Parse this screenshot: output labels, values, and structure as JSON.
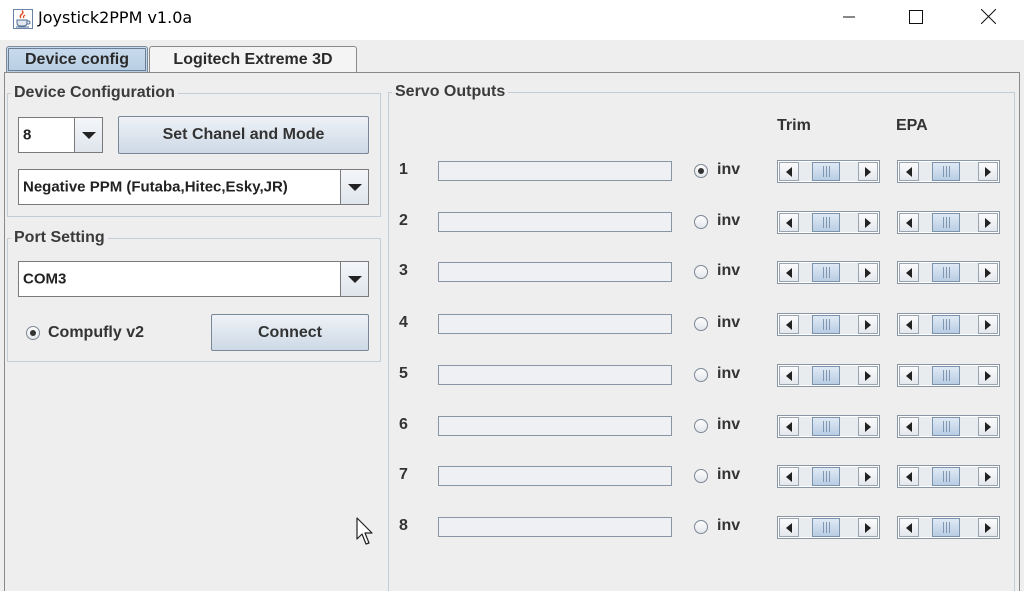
{
  "window": {
    "title": "Joystick2PPM v1.0a",
    "minimize_glyph": "─",
    "maximize_glyph": "☐",
    "close_glyph": "✕"
  },
  "tabs": [
    {
      "label": "Device config",
      "active": true
    },
    {
      "label": "Logitech Extreme 3D",
      "active": false
    }
  ],
  "device_configuration": {
    "title": "Device Configuration",
    "channels_value": "8",
    "set_button_label": "Set Chanel and Mode",
    "mode_value": "Negative PPM (Futaba,Hitec,Esky,JR)"
  },
  "port_setting": {
    "title": "Port Setting",
    "port_value": "COM3",
    "radio_label": "Compufly v2",
    "radio_selected": true,
    "connect_button_label": "Connect"
  },
  "servo_outputs": {
    "title": "Servo Outputs",
    "trim_header": "Trim",
    "epa_header": "EPA",
    "inv_label": "inv",
    "rows": [
      {
        "num": "1",
        "inv": true
      },
      {
        "num": "2",
        "inv": false
      },
      {
        "num": "3",
        "inv": false
      },
      {
        "num": "4",
        "inv": false
      },
      {
        "num": "5",
        "inv": false
      },
      {
        "num": "6",
        "inv": false
      },
      {
        "num": "7",
        "inv": false
      },
      {
        "num": "8",
        "inv": false
      }
    ]
  },
  "colors": {
    "panel_bg": "#eeeeee",
    "tab_active": "#b8cde3",
    "button_gradient_bottom": "#cdd9e6",
    "group_border": "#c3cdd8"
  },
  "icons": [
    "java-cup-icon",
    "minimize-icon",
    "maximize-icon",
    "close-icon",
    "chevron-down-icon",
    "arrow-left-icon",
    "arrow-right-icon",
    "mouse-cursor-icon"
  ]
}
